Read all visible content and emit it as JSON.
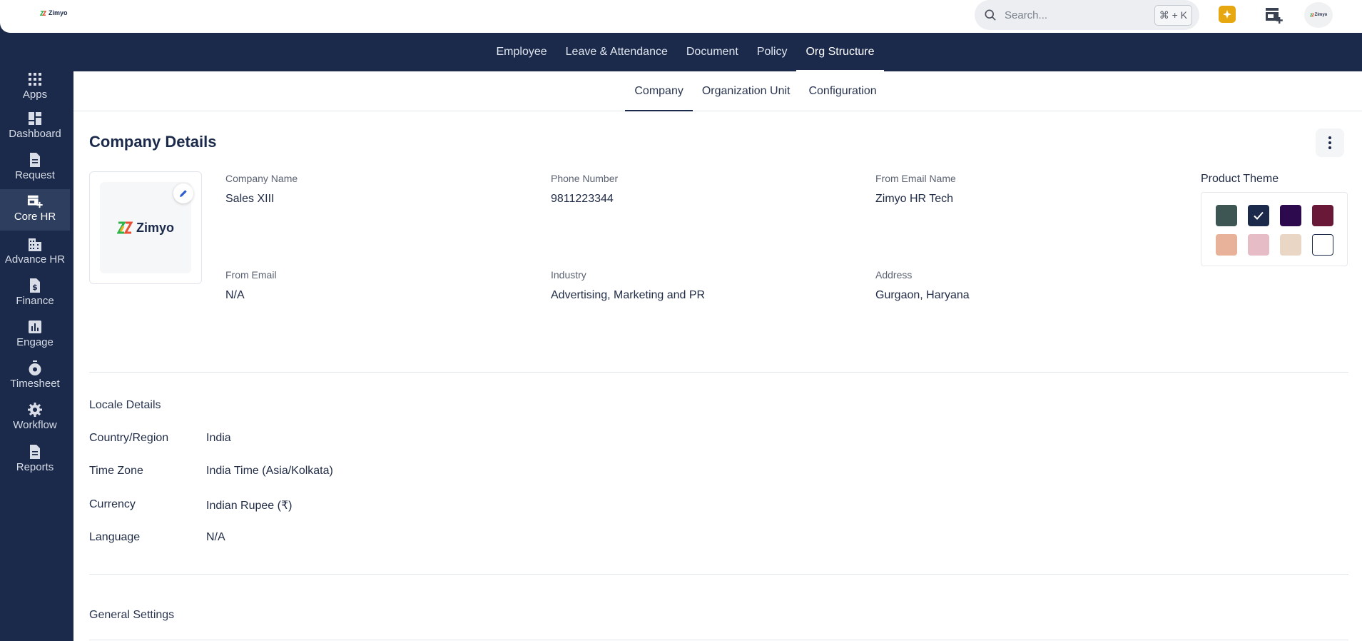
{
  "topbar": {
    "logo_text": "Zimyo",
    "search_placeholder": "Search...",
    "search_shortcut": "⌘ + K",
    "avatar_text": "Zimyo"
  },
  "main_nav": {
    "items": [
      {
        "label": "Employee"
      },
      {
        "label": "Leave & Attendance"
      },
      {
        "label": "Document"
      },
      {
        "label": "Policy"
      },
      {
        "label": "Org Structure",
        "active": true
      }
    ]
  },
  "sidebar": {
    "items": [
      {
        "label": "Apps",
        "icon": "grid-icon"
      },
      {
        "label": "Dashboard",
        "icon": "dashboard-icon"
      },
      {
        "label": "Request",
        "icon": "document-icon"
      },
      {
        "label": "Core HR",
        "icon": "store-add-icon",
        "active": true
      },
      {
        "label": "Advance HR",
        "icon": "building-icon"
      },
      {
        "label": "Finance",
        "icon": "finance-icon"
      },
      {
        "label": "Engage",
        "icon": "bar-chart-icon"
      },
      {
        "label": "Timesheet",
        "icon": "timer-icon"
      },
      {
        "label": "Workflow",
        "icon": "gear-icon"
      },
      {
        "label": "Reports",
        "icon": "report-icon"
      }
    ]
  },
  "sub_nav": {
    "tabs": [
      {
        "label": "Company",
        "active": true
      },
      {
        "label": "Organization Unit"
      },
      {
        "label": "Configuration"
      }
    ]
  },
  "company": {
    "title": "Company Details",
    "logo_text": "Zimyo",
    "fields": [
      {
        "label": "Company Name",
        "value": "Sales XIII"
      },
      {
        "label": "Phone Number",
        "value": "9811223344"
      },
      {
        "label": "From Email Name",
        "value": "Zimyo HR Tech"
      },
      {
        "label": "From Email",
        "value": "N/A"
      },
      {
        "label": "Industry",
        "value": "Advertising, Marketing and PR"
      },
      {
        "label": "Address",
        "value": "Gurgaon, Haryana"
      }
    ],
    "theme": {
      "label": "Product Theme",
      "swatches": [
        "#3d5654",
        "#1b2a4a",
        "#2d0a4e",
        "#6a1838",
        "#e8b29a",
        "#e6bcc6",
        "#e9d6c4",
        "#ffffff"
      ],
      "selected_index": 1
    }
  },
  "locale": {
    "title": "Locale Details",
    "rows": [
      {
        "key": "Country/Region",
        "value": "India"
      },
      {
        "key": "Time Zone",
        "value": "India Time (Asia/Kolkata)"
      },
      {
        "key": "Currency",
        "value": "Indian Rupee (₹)"
      },
      {
        "key": "Language",
        "value": "N/A"
      }
    ]
  },
  "general": {
    "title": "General Settings"
  }
}
